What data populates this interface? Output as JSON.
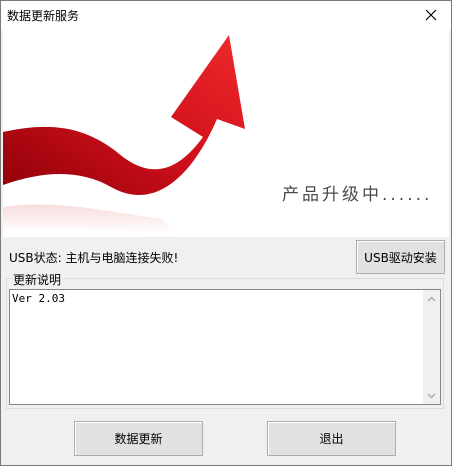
{
  "window": {
    "title": "数据更新服务",
    "close_icon": "close-icon"
  },
  "banner": {
    "text": "产品升级中......",
    "graphic": "growth-arrow"
  },
  "status": {
    "text": "USB状态: 主机与电脑连接失败!"
  },
  "buttons": {
    "usb_driver_install": "USB驱动安装",
    "data_update": "数据更新",
    "exit": "退出"
  },
  "update_notes": {
    "label": "更新说明",
    "content": "Ver 2.03"
  },
  "colors": {
    "arrow_red": "#d0101c",
    "window_bg": "#f0f0f0"
  }
}
